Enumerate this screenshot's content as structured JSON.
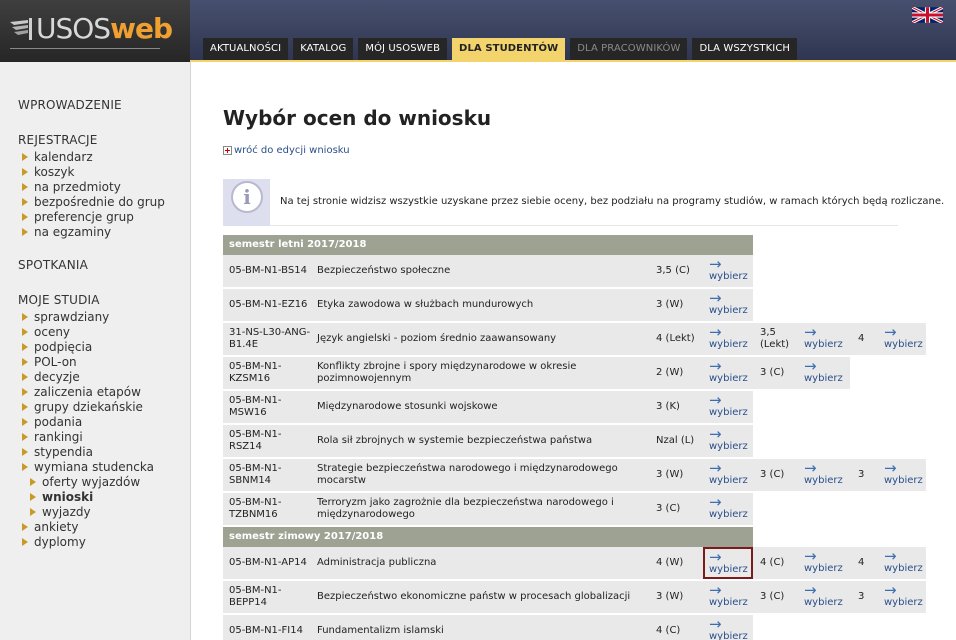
{
  "header": {
    "logo_text_light": "USOS",
    "logo_text_bold": "web",
    "nav": [
      {
        "label": "AKTUALNOŚCI",
        "state": "normal"
      },
      {
        "label": "KATALOG",
        "state": "normal"
      },
      {
        "label": "MÓJ USOSWEB",
        "state": "normal"
      },
      {
        "label": "DLA STUDENTÓW",
        "state": "active"
      },
      {
        "label": "DLA PRACOWNIKÓW",
        "state": "disabled"
      },
      {
        "label": "DLA WSZYSTKICH",
        "state": "normal"
      }
    ],
    "language_icon": "uk-flag-icon"
  },
  "sidebar": {
    "sections": [
      {
        "title": "WPROWADZENIE",
        "items": []
      },
      {
        "title": "REJESTRACJE",
        "items": [
          {
            "label": "kalendarz"
          },
          {
            "label": "koszyk"
          },
          {
            "label": "na przedmioty"
          },
          {
            "label": "bezpośrednie do grup"
          },
          {
            "label": "preferencje grup"
          },
          {
            "label": "na egzaminy"
          }
        ]
      },
      {
        "title": "SPOTKANIA",
        "items": []
      },
      {
        "title": "MOJE STUDIA",
        "items": [
          {
            "label": "sprawdziany"
          },
          {
            "label": "oceny"
          },
          {
            "label": "podpięcia"
          },
          {
            "label": "POL-on"
          },
          {
            "label": "decyzje"
          },
          {
            "label": "zaliczenia etapów"
          },
          {
            "label": "grupy dziekańskie"
          },
          {
            "label": "podania"
          },
          {
            "label": "rankingi"
          },
          {
            "label": "stypendia"
          },
          {
            "label": "wymiana studencka"
          },
          {
            "label": "oferty wyjazdów",
            "sub": true
          },
          {
            "label": "wnioski",
            "sub": true,
            "current": true
          },
          {
            "label": "wyjazdy",
            "sub": true
          },
          {
            "label": "ankiety"
          },
          {
            "label": "dyplomy"
          }
        ]
      }
    ]
  },
  "main": {
    "title": "Wybór ocen do wniosku",
    "back_link": "wróć do edycji wniosku",
    "info_glyph": "i",
    "info_text": "Na tej stronie widzisz wszystkie uzyskane przez siebie oceny, bez podziału na programy studiów, w ramach których będą rozliczane.",
    "pick_label": "wybierz",
    "semesters": [
      {
        "title": "semestr letni 2017/2018",
        "rows": [
          {
            "code": "05-BM-N1-BS14",
            "name": "Bezpieczeństwo społeczne",
            "grades": [
              "3,5 (C)"
            ]
          },
          {
            "code": "05-BM-N1-EZ16",
            "name": "Etyka zawodowa w służbach mundurowych",
            "grades": [
              "3 (W)"
            ]
          },
          {
            "code": "31-NS-L30-ANG-B1.4E",
            "name": "Język angielski - poziom średnio zaawansowany",
            "grades": [
              "4 (Lekt)",
              "3,5 (Lekt)",
              "4"
            ]
          },
          {
            "code": "05-BM-N1-KZSM16",
            "name": "Konflikty zbrojne i spory międzynarodowe w okresie pozimnowojennym",
            "grades": [
              "2 (W)",
              "3 (C)"
            ]
          },
          {
            "code": "05-BM-N1-MSW16",
            "name": "Międzynarodowe stosunki wojskowe",
            "grades": [
              "3 (K)"
            ]
          },
          {
            "code": "05-BM-N1-RSZ14",
            "name": "Rola sił zbrojnych w systemie bezpieczeństwa państwa",
            "grades": [
              "Nzal (L)"
            ]
          },
          {
            "code": "05-BM-N1-SBNM14",
            "name": "Strategie bezpieczeństwa narodowego i międzynarodowego mocarstw",
            "grades": [
              "3 (W)",
              "3 (C)",
              "3"
            ]
          },
          {
            "code": "05-BM-N1-TZBNM16",
            "name": "Terroryzm jako zagrożnie dla bezpieczeństwa narodowego i międzynarodowego",
            "grades": [
              "3 (C)"
            ]
          }
        ]
      },
      {
        "title": "semestr zimowy 2017/2018",
        "rows": [
          {
            "code": "05-BM-N1-AP14",
            "name": "Administracja publiczna",
            "grades": [
              "4 (W)",
              "4 (C)",
              "4"
            ],
            "selected_pick": 0
          },
          {
            "code": "05-BM-N1-BEPP14",
            "name": "Bezpieczeństwo ekonomiczne państw w procesach globalizacji",
            "grades": [
              "3 (W)",
              "3 (C)",
              "3"
            ]
          },
          {
            "code": "05-BM-N1-FI14",
            "name": "Fundamentalizm islamski",
            "grades": [
              "4 (C)"
            ]
          }
        ]
      }
    ]
  }
}
